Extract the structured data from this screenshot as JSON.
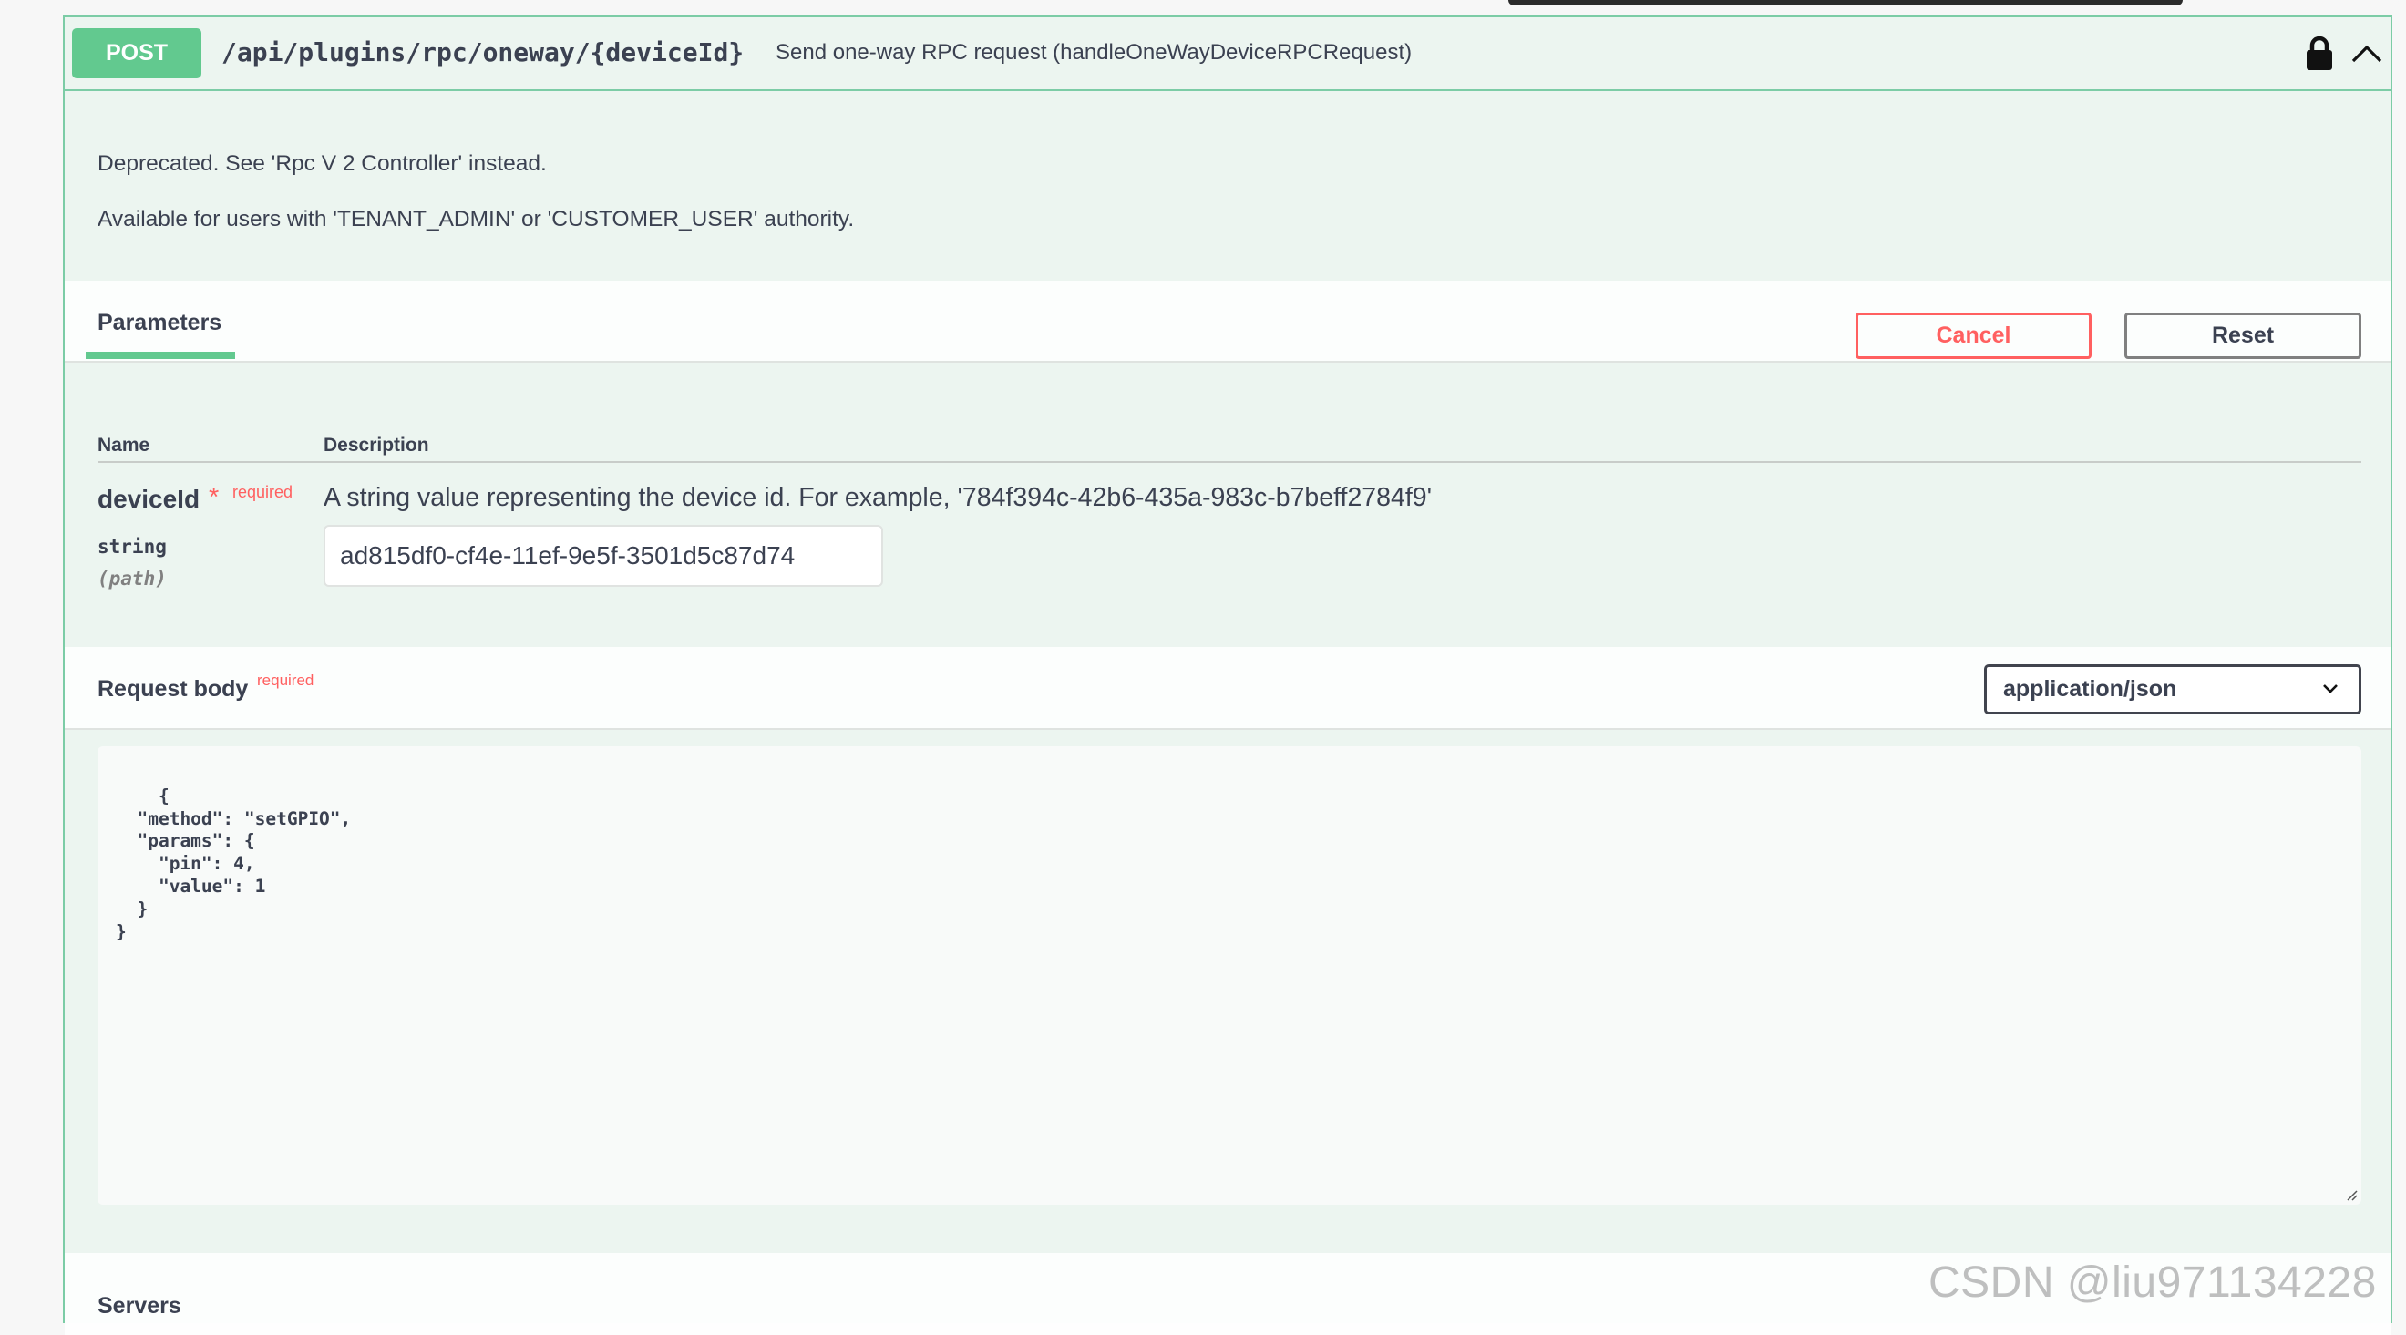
{
  "operation": {
    "method": "POST",
    "path": "/api/plugins/rpc/oneway/{deviceId}",
    "summary": "Send one-way RPC request (handleOneWayDeviceRPCRequest)",
    "method_color": "#62c98f",
    "icons": [
      "lock-icon",
      "collapse-icon"
    ]
  },
  "description": {
    "line1": "Deprecated. See 'Rpc V 2 Controller' instead.",
    "line2": "Available for users with 'TENANT_ADMIN' or 'CUSTOMER_USER' authority."
  },
  "parameters": {
    "tab_label": "Parameters",
    "cancel_label": "Cancel",
    "reset_label": "Reset",
    "columns": [
      "Name",
      "Description"
    ],
    "items": [
      {
        "name": "deviceId",
        "required_star": "*",
        "required_label": "required",
        "type": "string",
        "in": "(path)",
        "description": "A string value representing the device id. For example, '784f394c-42b6-435a-983c-b7beff2784f9'",
        "value": "ad815df0-cf4e-11ef-9e5f-3501d5c87d74"
      }
    ]
  },
  "request_body": {
    "title": "Request body",
    "required_label": "required",
    "content_type": "application/json",
    "content_type_options": [
      "application/json"
    ],
    "body": "{\n  \"method\": \"setGPIO\",\n  \"params\": {\n    \"pin\": 4,\n    \"value\": 1\n  }\n}"
  },
  "servers": {
    "title": "Servers"
  },
  "watermark": "CSDN @liu971134228",
  "colors": {
    "accent": "#62c98f",
    "border": "#7ccca6",
    "danger": "#ff6060",
    "background": "#ecf5f0"
  }
}
